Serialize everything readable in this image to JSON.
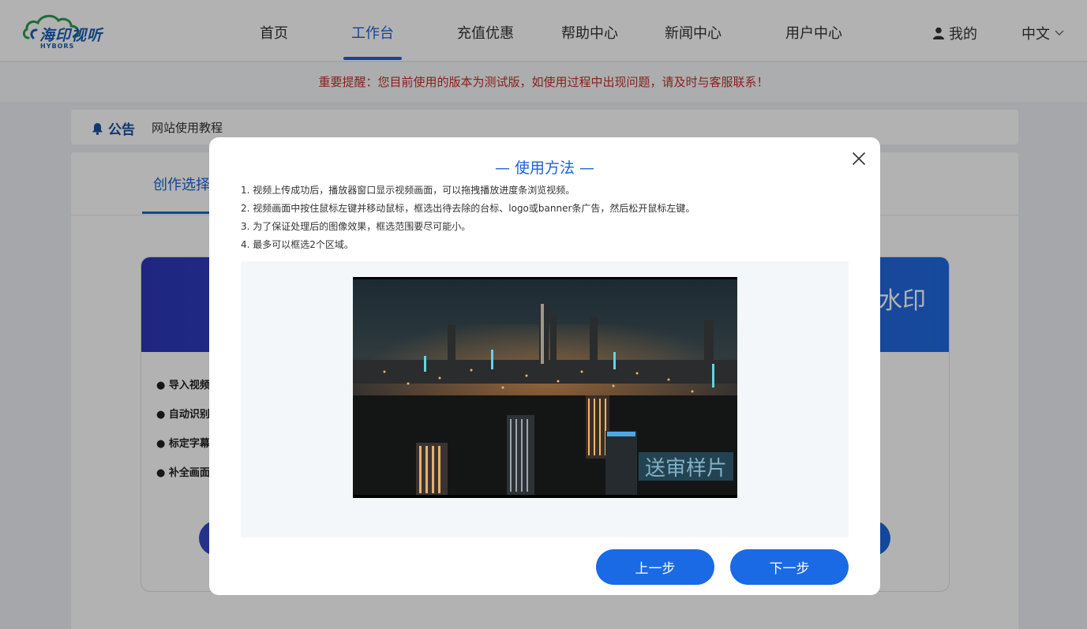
{
  "header": {
    "logo_text": "海印视听",
    "logo_sub": "HYBORS",
    "nav": [
      {
        "label": "首页"
      },
      {
        "label": "工作台"
      },
      {
        "label": "充值优惠"
      },
      {
        "label": "帮助中心"
      },
      {
        "label": "新闻中心"
      },
      {
        "label": "用户中心"
      }
    ],
    "active_nav": "工作台",
    "user_label": "我的",
    "language": "中文",
    "accent_color": "#1a63d6"
  },
  "notice": {
    "text": "重要提醒：您目前使用的版本为测试版，如使用过程中出现问题，请及时与客服联系！",
    "color": "#c0312b"
  },
  "announcement": {
    "label": "公告",
    "text": "网站使用教程"
  },
  "workspace": {
    "tab_label": "创作选择",
    "banner_text": "水印",
    "features": [
      "导入视频",
      "自动识别",
      "标定字幕",
      "补全画面"
    ]
  },
  "modal": {
    "title": "— 使用方法 —",
    "steps": [
      "1. 视频上传成功后，播放器窗口显示视频画面，可以拖拽播放进度条浏览视频。",
      "2. 视频画面中按住鼠标左键并移动鼠标，框选出待去除的台标、logo或banner条广告，然后松开鼠标左键。",
      "3. 为了保证处理后的图像效果，框选范围要尽可能小。",
      "4. 最多可以框选2个区域。"
    ],
    "watermark_text": "送审样片",
    "prev_label": "上一步",
    "next_label": "下一步",
    "button_color": "#1a6ae6"
  }
}
